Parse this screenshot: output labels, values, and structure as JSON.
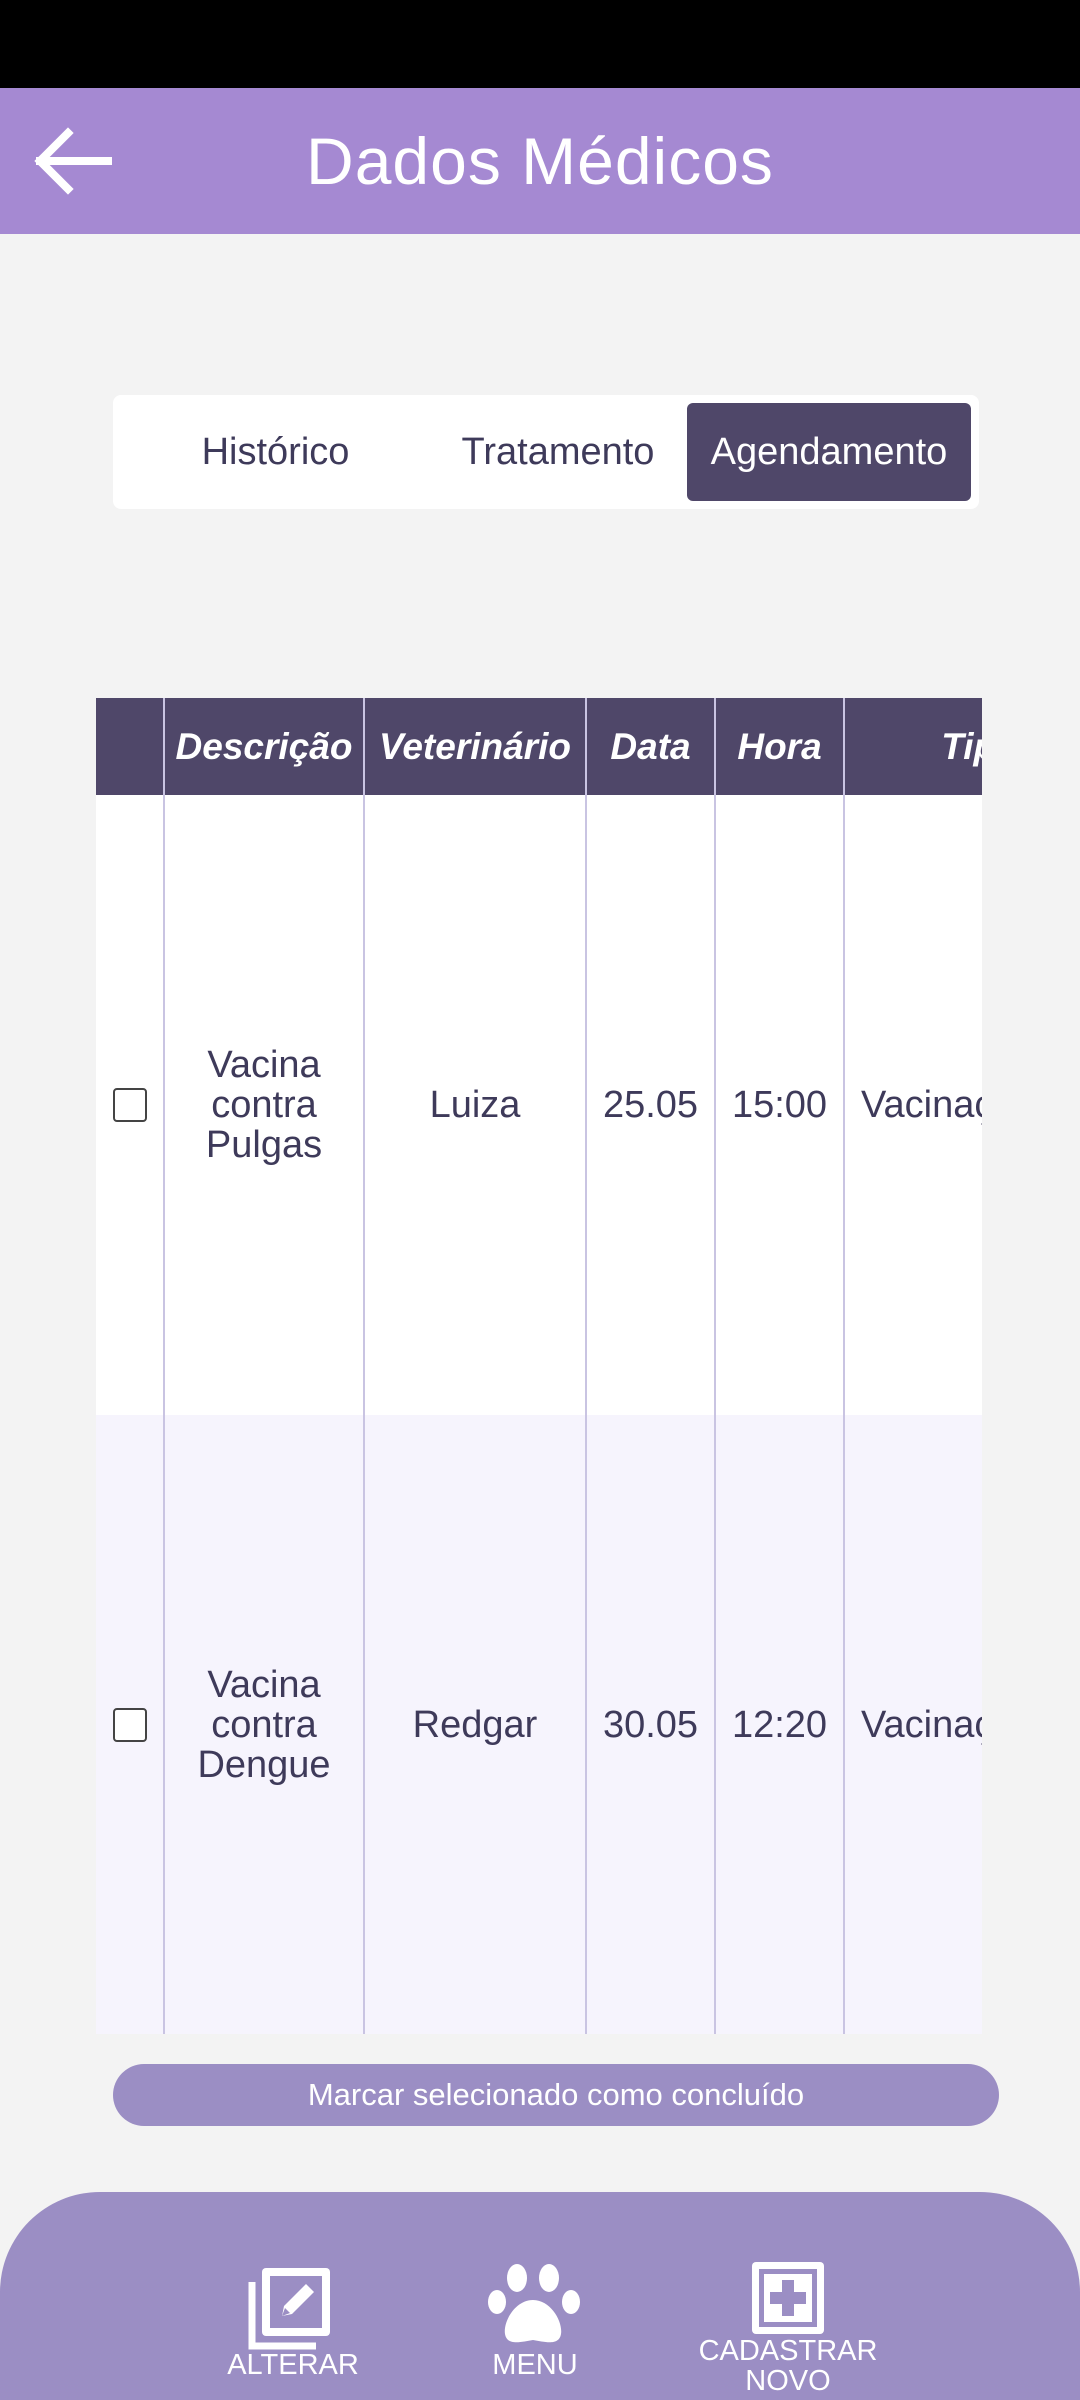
{
  "app_bar": {
    "title": "Dados Médicos"
  },
  "tabs": [
    {
      "label": "Histórico",
      "active": false
    },
    {
      "label": "Tratamento",
      "active": false
    },
    {
      "label": "Agendamento",
      "active": true
    }
  ],
  "table": {
    "columns": [
      "Descrição",
      "Veterinário",
      "Data",
      "Hora",
      "Tipo"
    ],
    "rows": [
      {
        "checked": false,
        "descricao": "Vacina contra Pulgas",
        "veterinario": "Luiza",
        "data": "25.05",
        "hora": "15:00",
        "tipo": "Vacinação"
      },
      {
        "checked": false,
        "descricao": "Vacina contra Dengue",
        "veterinario": "Redgar",
        "data": "30.05",
        "hora": "12:20",
        "tipo": "Vacinação"
      }
    ]
  },
  "mark_done_button": "Marcar selecionado como concluído",
  "bottom_nav": {
    "alterar": "ALTERAR",
    "menu": "MENU",
    "cadastrar": "CADASTRAR NOVO"
  },
  "colors": {
    "header": "#a589d2",
    "accent": "#4f4769",
    "nav": "#9b8ec4"
  }
}
